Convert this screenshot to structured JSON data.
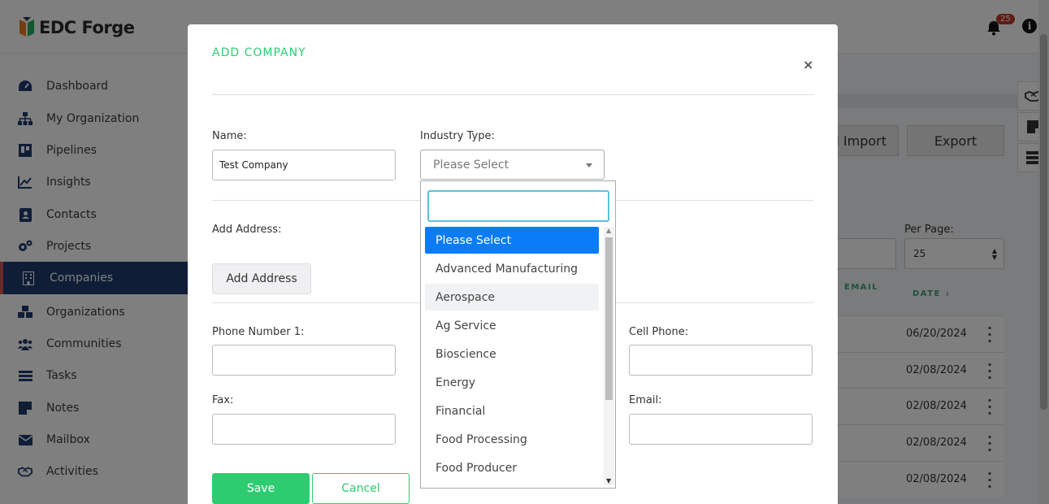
{
  "app": {
    "logo_text": "EDC Forge",
    "notification_count": "25",
    "info_glyph": "i"
  },
  "sidebar": {
    "items": [
      {
        "label": "Dashboard",
        "icon": "dashboard-icon"
      },
      {
        "label": "My Organization",
        "icon": "org-chart-icon"
      },
      {
        "label": "Pipelines",
        "icon": "pipeline-icon"
      },
      {
        "label": "Insights",
        "icon": "chart-line-icon"
      },
      {
        "label": "Contacts",
        "icon": "contact-card-icon"
      },
      {
        "label": "Projects",
        "icon": "gears-icon"
      },
      {
        "label": "Companies",
        "icon": "building-icon",
        "active": true
      },
      {
        "label": "Organizations",
        "icon": "cubes-icon"
      },
      {
        "label": "Communities",
        "icon": "users-icon"
      },
      {
        "label": "Tasks",
        "icon": "tasks-icon"
      },
      {
        "label": "Notes",
        "icon": "note-icon"
      },
      {
        "label": "Mailbox",
        "icon": "envelope-icon"
      },
      {
        "label": "Activities",
        "icon": "handshake-icon"
      }
    ]
  },
  "background": {
    "import_label": "l Import",
    "export_label": "Export",
    "per_page_label": "Per Page:",
    "per_page_value": "25",
    "col_email": "EMAIL",
    "col_date": "DATE",
    "rows": [
      "06/20/2024",
      "02/08/2024",
      "02/08/2024",
      "02/08/2024",
      "02/08/2024"
    ]
  },
  "modal": {
    "title": "ADD COMPANY",
    "close_glyph": "×",
    "name_label": "Name:",
    "name_value": "Test Company",
    "industry_label": "Industry Type:",
    "industry_value": "Please Select",
    "add_address_label": "Add Address:",
    "add_address_button": "Add Address",
    "phone1_label": "Phone Number 1:",
    "cell_label": "Cell Phone:",
    "fax_label": "Fax:",
    "email_label": "Email:",
    "save_label": "Save",
    "cancel_label": "Cancel"
  },
  "dropdown": {
    "search_value": "",
    "options": [
      "Please Select",
      "Advanced Manufacturing",
      "Aerospace",
      "Ag Service",
      "Bioscience",
      "Energy",
      "Financial",
      "Food Processing",
      "Food Producer"
    ],
    "selected_index": 0,
    "hover_index": 2
  },
  "colors": {
    "accent_green": "#2ecc71",
    "nav_active": "#1f3a6e",
    "option_selected": "#0a7cf7"
  }
}
